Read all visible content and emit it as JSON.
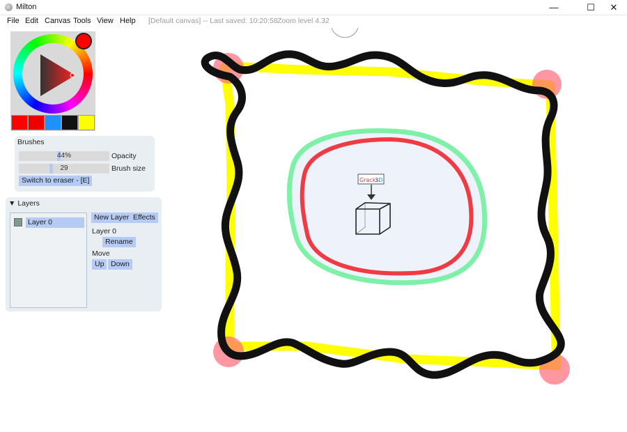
{
  "window": {
    "title": "Milton",
    "minimize": "—",
    "maximize": "☐",
    "close": "✕"
  },
  "menu": {
    "items": [
      "File",
      "Edit",
      "Canvas",
      "Tools",
      "View",
      "Help"
    ],
    "status": "[Default canvas] -- Last saved: 10:20:58",
    "zoom": "Zoom level 4.32"
  },
  "picker": {
    "current_color": "#ff0000",
    "swatches": [
      "#ff0000",
      "#ee0000",
      "#1e90ff",
      "#111111",
      "#ffff00"
    ]
  },
  "brushes": {
    "title": "Brushes",
    "opacity_value": "44%",
    "opacity_fraction": 0.44,
    "opacity_label": "Opacity",
    "size_value": "29",
    "size_fraction": 0.35,
    "size_label": "Brush size",
    "eraser_button": "Switch to eraser - [E]"
  },
  "layers": {
    "title": "Layers",
    "collapse_glyph": "▼",
    "items": [
      "Layer 0"
    ],
    "new_layer_button": "New Layer",
    "effects_button": "Effects",
    "selected_layer_label": "Layer 0",
    "rename_button": "Rename",
    "move_label": "Move",
    "up_button": "Up",
    "down_button": "Down"
  },
  "canvas": {
    "sign_text_red": "Gracks",
    "sign_text_blue": "3D"
  }
}
